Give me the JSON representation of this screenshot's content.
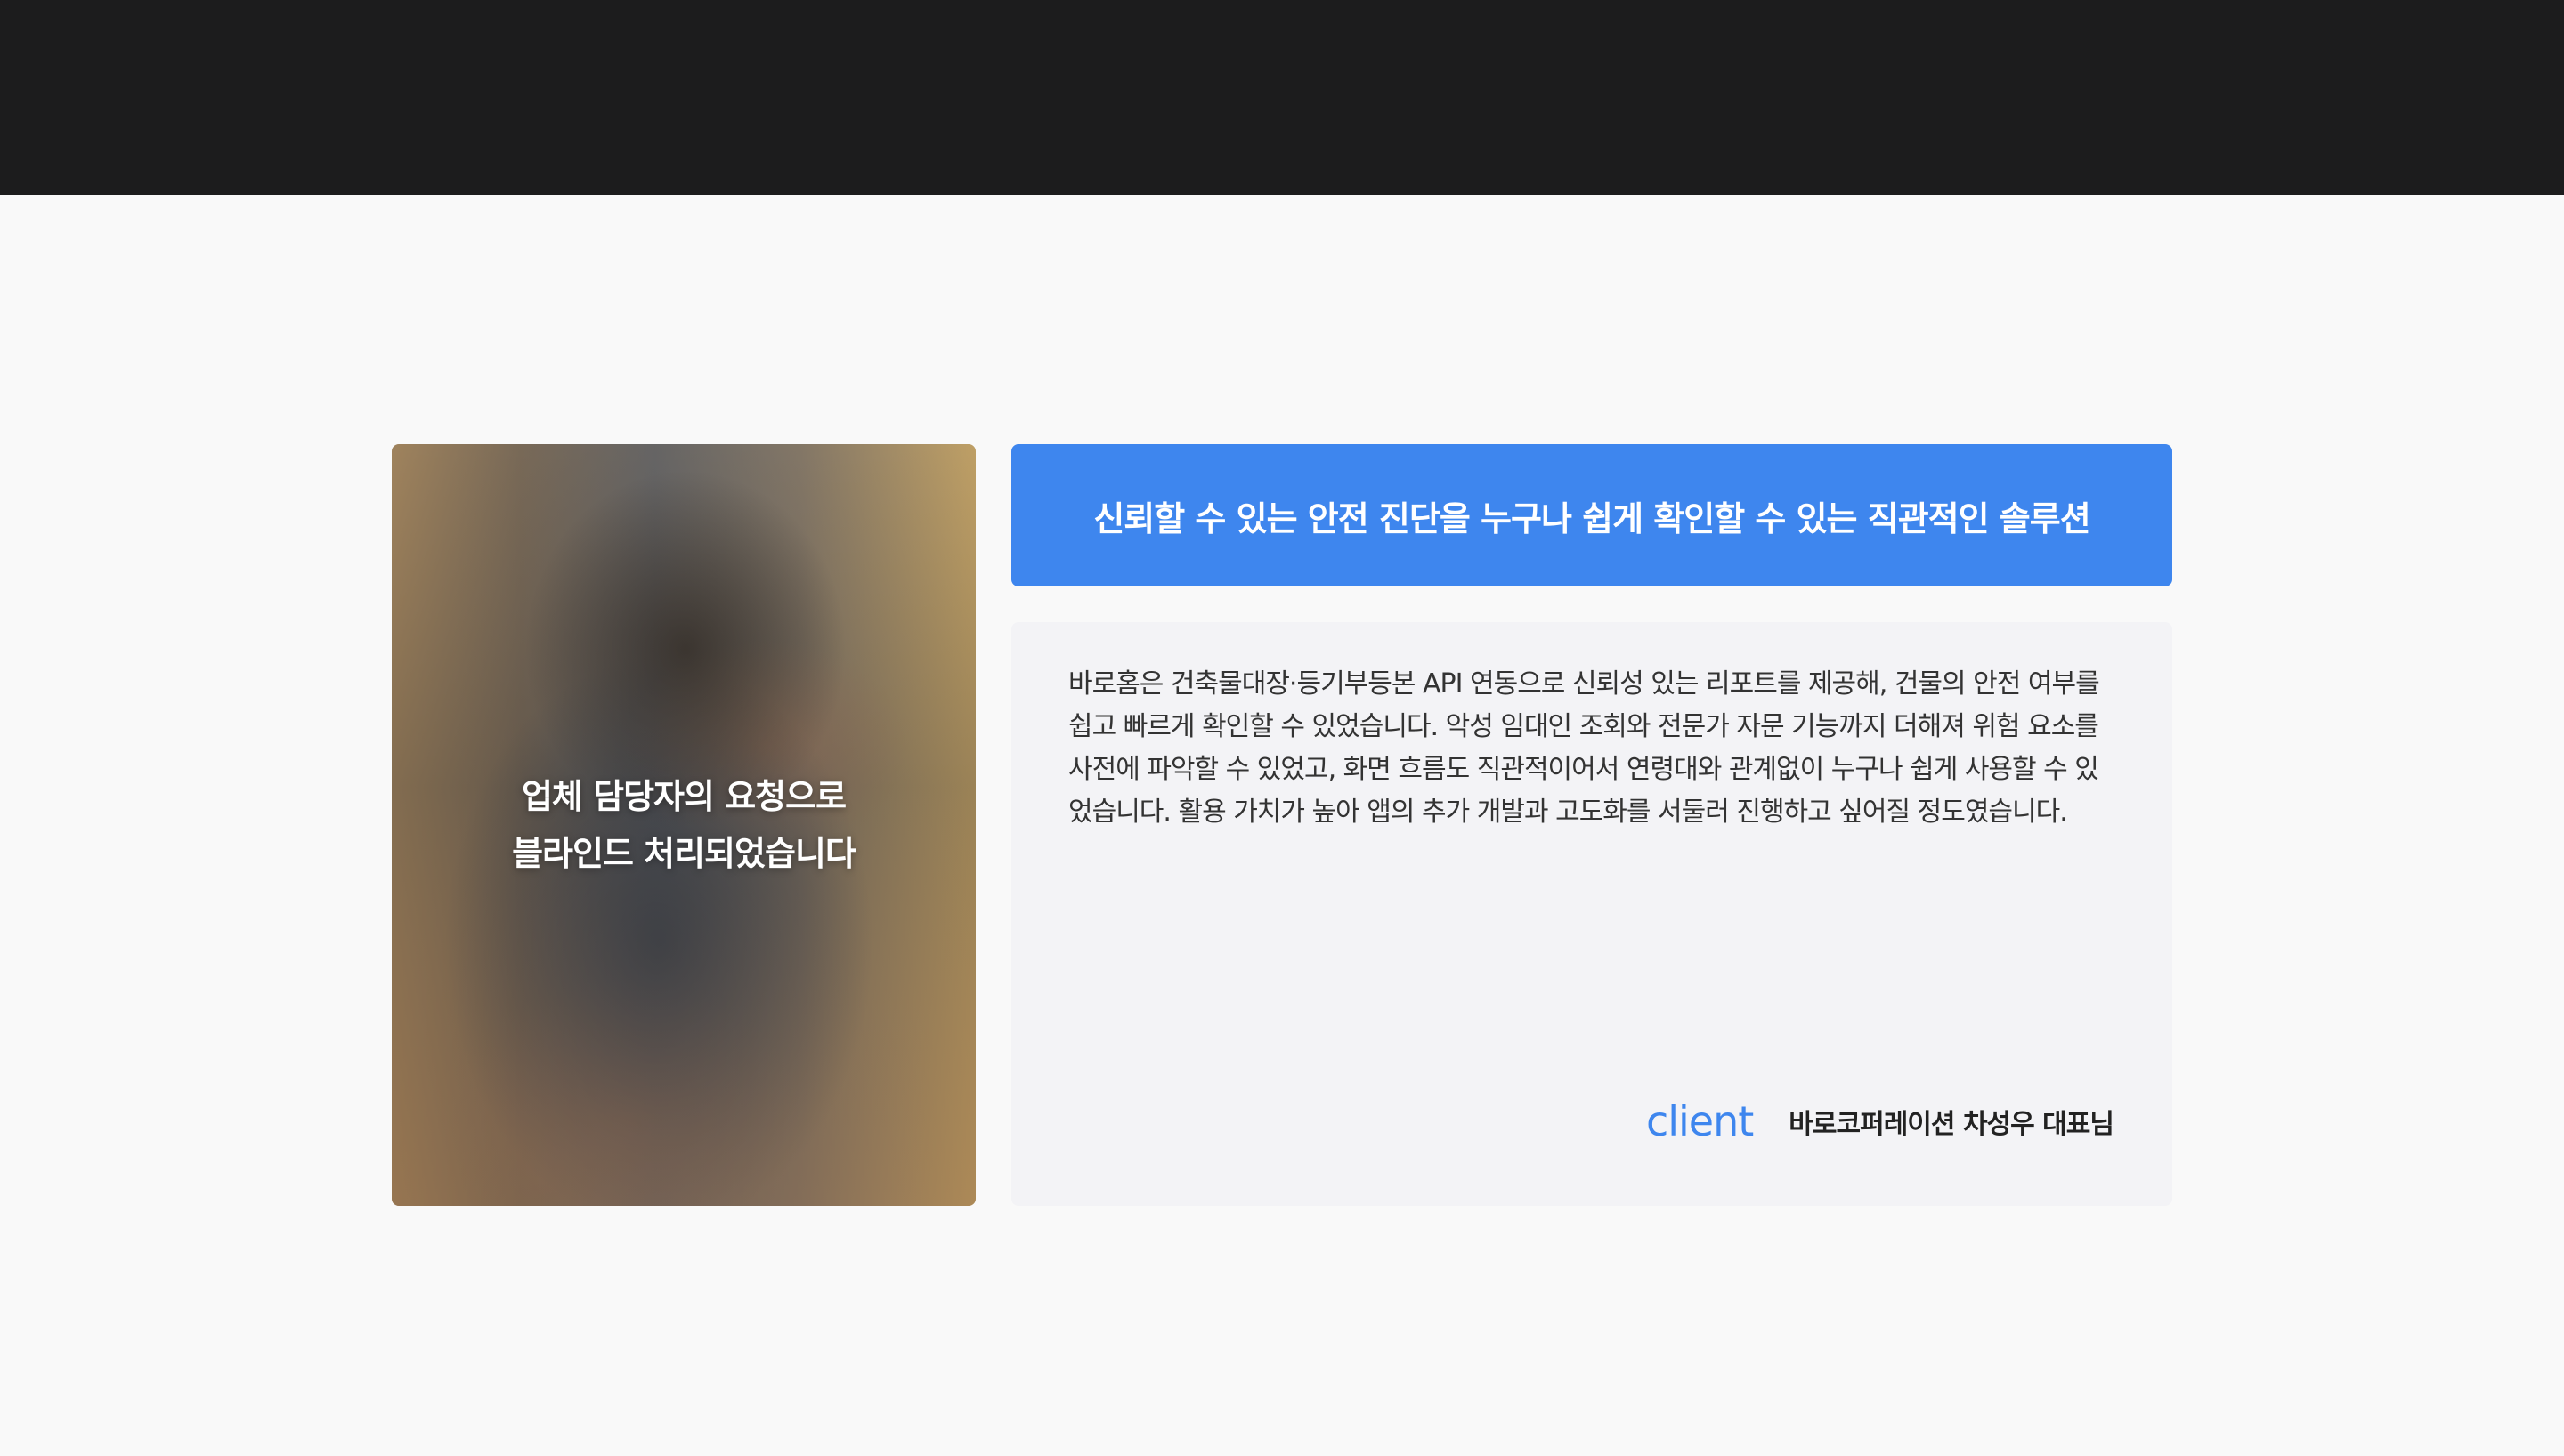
{
  "header": {
    "background_color": "#1c1c1d"
  },
  "photo_card": {
    "image": "blurred-person-writing-photo",
    "overlay_line_1": "업체 담당자의 요청으로",
    "overlay_line_2": "블라인드 처리되었습니다"
  },
  "headline": {
    "text": "신뢰할 수 있는 안전 진단을 누구나 쉽게 확인할 수 있는 직관적인 솔루션",
    "background_color": "#3e86ee"
  },
  "review": {
    "body": "바로홈은 건축물대장·등기부등본 API 연동으로 신뢰성 있는 리포트를 제공해, 건물의 안전 여부를 쉽고 빠르게 확인할 수 있었습니다. 악성 임대인 조회와 전문가 자문 기능까지 더해져 위험 요소를 사전에 파악할 수 있었고, 화면 흐름도 직관적이어서 연령대와 관계없이 누구나 쉽게 사용할 수 있었습니다. 활용 가치가 높아 앱의 추가 개발과 고도화를 서둘러 진행하고 싶어질 정도였습니다.",
    "client_label": "client",
    "client_name": "바로코퍼레이션 차성우 대표님",
    "accent_color": "#3e86ee"
  }
}
